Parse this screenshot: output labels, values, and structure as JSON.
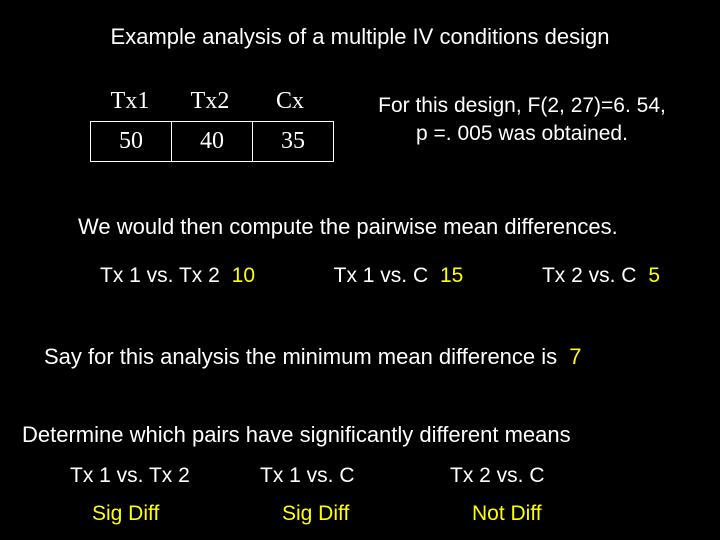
{
  "title": "Example analysis of a multiple IV conditions design",
  "conditions": {
    "headers": {
      "c1": "Tx1",
      "c2": "Tx2",
      "c3": "Cx"
    },
    "values": {
      "c1": "50",
      "c2": "40",
      "c3": "35"
    }
  },
  "fstat": {
    "line1": "For this design, F(2, 27)=6. 54,",
    "line2": "p =. 005 was obtained."
  },
  "pairwise_intro": "We would then compute the pairwise mean differences.",
  "pairdiffs": {
    "p1": {
      "label": "Tx 1 vs. Tx 2",
      "value": "10"
    },
    "p2": {
      "label": "Tx 1 vs. C",
      "value": "15"
    },
    "p3": {
      "label": "Tx 2 vs. C",
      "value": "5"
    }
  },
  "min_mean": {
    "text": "Say for this analysis the minimum mean difference is",
    "value": "7"
  },
  "determine": "Determine which pairs have significantly different means",
  "sig": {
    "p1": {
      "label": "Tx 1 vs. Tx 2",
      "result": "Sig Diff"
    },
    "p2": {
      "label": "Tx 1 vs. C",
      "result": "Sig Diff"
    },
    "p3": {
      "label": "Tx 2 vs. C",
      "result": "Not Diff"
    }
  }
}
